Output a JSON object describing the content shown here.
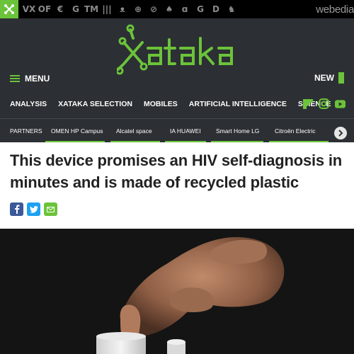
{
  "network": {
    "sites": [
      "VX",
      "OF",
      "€",
      "G",
      "TM",
      "|||",
      "ᴥ",
      "⊕",
      "⊘",
      "♠",
      "ɑ",
      "G",
      "D",
      "♞"
    ],
    "brand": "webedia"
  },
  "header": {
    "logo_text": "xataka",
    "menu_label": "MENU",
    "new_label": "NEW",
    "categories": [
      "ANALYSIS",
      "XATAKA SELECTION",
      "MOBILES",
      "ARTIFICIAL INTELLIGENCE",
      "SCIENCE"
    ],
    "partners": [
      "PARTNERS",
      "OMEN HP Campus",
      "Alcatel space",
      "IA HUAWEI",
      "Smart Home LG",
      "Citroën Electric"
    ]
  },
  "article": {
    "title": "This device promises an HIV self-diagnosis in minutes and is made of recycled plastic"
  },
  "colors": {
    "accent": "#6bc33a",
    "header_bg": "#2c2f33",
    "facebook": "#3b5998",
    "twitter": "#1da1f2",
    "email": "#6bc33a"
  },
  "icons": {
    "network_logo": "network-logo-icon",
    "flipboard": "flipboard-icon",
    "instagram": "instagram-icon",
    "youtube": "youtube-icon",
    "facebook": "facebook-icon",
    "twitter": "twitter-icon",
    "email": "email-icon",
    "next": "chevron-right-icon"
  }
}
